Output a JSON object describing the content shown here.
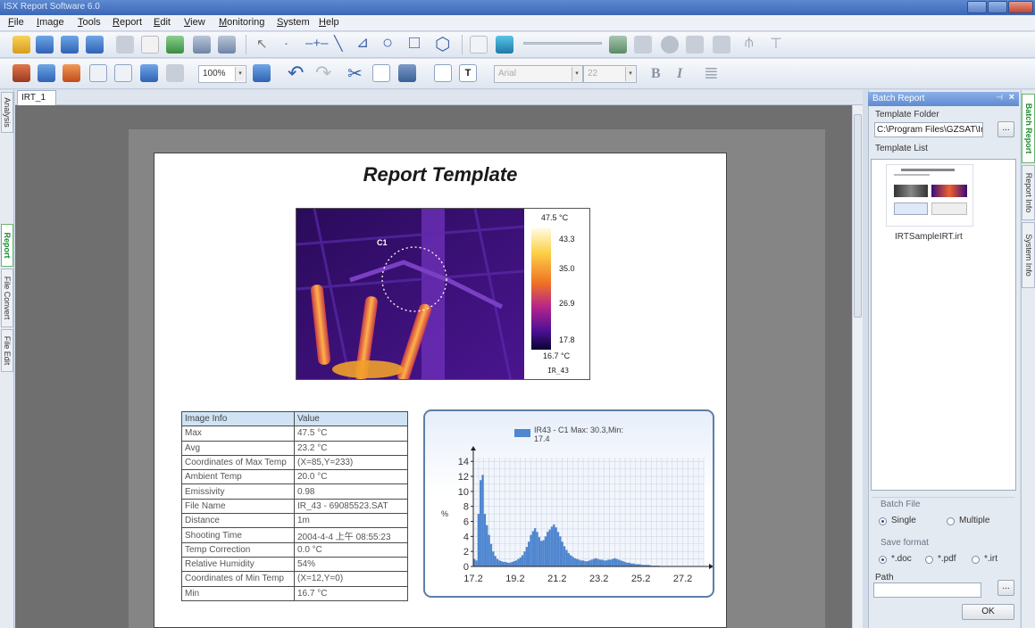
{
  "window": {
    "title": "ISX Report Software 6.0",
    "colors": {
      "titlebar": "#4a74c0",
      "accent_green": "#1b8a2e"
    }
  },
  "menu": [
    "File",
    "Image",
    "Tools",
    "Report",
    "Edit",
    "View",
    "Monitoring",
    "System",
    "Help"
  ],
  "toolbar2": {
    "zoom": "100%",
    "font": "Arial",
    "font_size": "22",
    "bold": "B",
    "italic": "I"
  },
  "left_tabs": [
    "Analysis",
    "Report",
    "File Convert",
    "File Edit"
  ],
  "doc_tab": {
    "label": "IRT_1",
    "close": "×"
  },
  "report": {
    "title": "Report Template",
    "thermal": {
      "marker": "C1",
      "max_label": "47.5 °C",
      "min_label": "16.7 °C",
      "scale": [
        "43.3",
        "35.0",
        "26.9",
        "17.8"
      ],
      "caption": "IR_43"
    },
    "table": {
      "header": [
        "Image Info",
        "Value"
      ],
      "rows": [
        [
          "Max",
          "47.5 °C"
        ],
        [
          "Avg",
          "23.2 °C"
        ],
        [
          "Coordinates of Max Temp",
          "(X=85,Y=233)"
        ],
        [
          "Ambient Temp",
          "20.0 °C"
        ],
        [
          "Emissivity",
          "0.98"
        ],
        [
          "File Name",
          "IR_43 - 69085523.SAT"
        ],
        [
          "Distance",
          "1m"
        ],
        [
          "Shooting Time",
          "2004-4-4 上午 08:55:23"
        ],
        [
          "Temp Correction",
          "0.0 °C"
        ],
        [
          "Relative Humidity",
          "54%"
        ],
        [
          "Coordinates of Min Temp",
          "(X=12,Y=0)"
        ],
        [
          "Min",
          "16.7 °C"
        ]
      ]
    }
  },
  "chart_data": {
    "type": "bar",
    "legend": "IR43 - C1 Max: 30.3,Min: 17.4",
    "ylabel": "%",
    "color": "#4f86cf",
    "x_ticks": [
      "17.2",
      "19.2",
      "21.2",
      "23.2",
      "25.2",
      "27.2"
    ],
    "y_ticks": [
      "0",
      "2",
      "4",
      "6",
      "8",
      "10",
      "12",
      "14"
    ],
    "xlim": [
      17.2,
      28.2
    ],
    "ylim": [
      0,
      14.5
    ],
    "x_start": 17.2,
    "bin_width": 0.1,
    "values": [
      1.0,
      0.8,
      7.0,
      11.5,
      12.2,
      7.0,
      5.5,
      4.2,
      3.0,
      2.0,
      1.4,
      1.0,
      0.8,
      0.7,
      0.6,
      0.6,
      0.5,
      0.5,
      0.6,
      0.7,
      0.8,
      1.0,
      1.2,
      1.5,
      2.0,
      2.6,
      3.3,
      4.2,
      4.7,
      5.1,
      4.6,
      3.9,
      3.4,
      3.5,
      4.0,
      4.6,
      4.9,
      5.3,
      5.6,
      5.2,
      4.6,
      4.0,
      3.3,
      2.7,
      2.2,
      1.8,
      1.5,
      1.3,
      1.1,
      1.0,
      0.9,
      0.8,
      0.8,
      0.7,
      0.7,
      0.8,
      0.9,
      1.0,
      1.1,
      1.0,
      0.9,
      0.9,
      0.8,
      0.8,
      0.9,
      0.9,
      1.0,
      1.1,
      1.0,
      0.9,
      0.8,
      0.7,
      0.6,
      0.5,
      0.5,
      0.4,
      0.4,
      0.3,
      0.3,
      0.3,
      0.2,
      0.2,
      0.2,
      0.2,
      0.15,
      0.1,
      0.1,
      0.1,
      0.1,
      0.05,
      0.05,
      0.05,
      0.05,
      0.05,
      0.05,
      0.05,
      0.05,
      0.05,
      0.05,
      0.05,
      0.05,
      0.05
    ]
  },
  "batch_panel": {
    "title": "Batch Report",
    "template_folder_label": "Template Folder",
    "template_folder_value": "C:\\Program Files\\GZSAT\\Ir",
    "browse": "...",
    "template_list_label": "Template List",
    "template_item": "IRTSampleIRT.irt",
    "batch_file_label": "Batch File",
    "batch_options": [
      "Single",
      "Multiple"
    ],
    "save_format_label": "Save format",
    "save_options": [
      "*.doc",
      "*.pdf",
      "*.irt"
    ],
    "path_label": "Path",
    "ok": "OK"
  },
  "right_tabs": [
    "Batch Report",
    "Report Info",
    "System Info"
  ]
}
